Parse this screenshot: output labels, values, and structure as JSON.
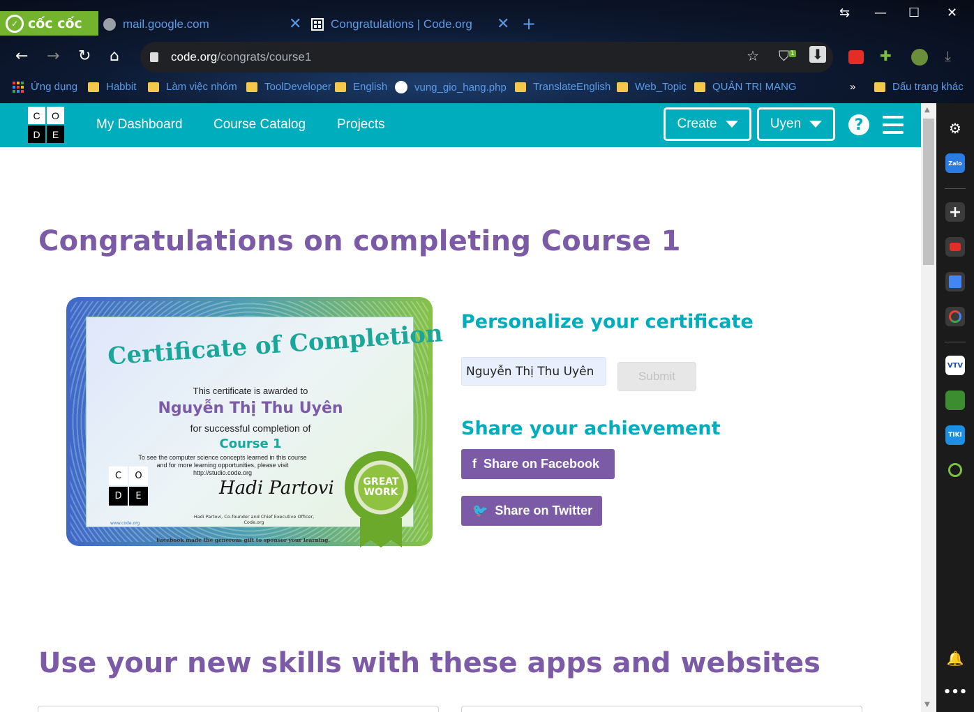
{
  "browser": {
    "brand": "cốc cốc",
    "tabs": [
      {
        "title": "mail.google.com"
      },
      {
        "title": "Congratulations | Code.org"
      }
    ],
    "url_host": "code.org",
    "url_path": "/congrats/course1",
    "extension_badge": "1",
    "bookmarks": [
      {
        "label": "Ứng dụng"
      },
      {
        "label": "Habbit"
      },
      {
        "label": "Làm việc nhóm"
      },
      {
        "label": "ToolDeveloper"
      },
      {
        "label": "English"
      },
      {
        "label": "vung_gio_hang.php"
      },
      {
        "label": "TranslateEnglish"
      },
      {
        "label": "Web_Topic"
      },
      {
        "label": "QUẢN TRỊ MẠNG"
      }
    ],
    "bookmarks_overflow": "»",
    "other_bookmarks": "Dấu trang khác"
  },
  "site": {
    "logo": [
      "C",
      "O",
      "D",
      "E"
    ],
    "nav": [
      "My Dashboard",
      "Course Catalog",
      "Projects"
    ],
    "create_label": "Create",
    "user_label": "Uyen",
    "help_label": "?"
  },
  "page": {
    "title": "Congratulations on completing Course 1",
    "personalize_heading": "Personalize your certificate",
    "name_value": "Nguyễn Thị Thu Uyên",
    "submit_label": "Submit",
    "share_heading": "Share your achievement",
    "facebook_label": "Share on Facebook",
    "twitter_label": "Share on Twitter",
    "skills_heading": "Use your new skills with these apps and websites"
  },
  "certificate": {
    "title": "Certificate of Completion",
    "awarded": "This certificate is awarded to",
    "name": "Nguyễn Thị Thu Uyên",
    "for": "for successful completion of",
    "course": "Course 1",
    "note_1": "To see the computer science concepts learned in this course",
    "note_2": "and for more learning opportunities, please visit",
    "note_3": "http://studio.code.org",
    "signature": "Hadi Partovi",
    "signer": "Hadi Partovi, Co-founder and Chief Executive Officer, Code.org",
    "www": "www.code.org",
    "footer": "Facebook made the generous gift to sponsor your learning.",
    "badge_line1": "GREAT",
    "badge_line2": "WORK"
  },
  "colors": {
    "brand_teal": "#00adbc",
    "brand_purple": "#7b5aa6",
    "coccoc_green": "#74b32e"
  }
}
